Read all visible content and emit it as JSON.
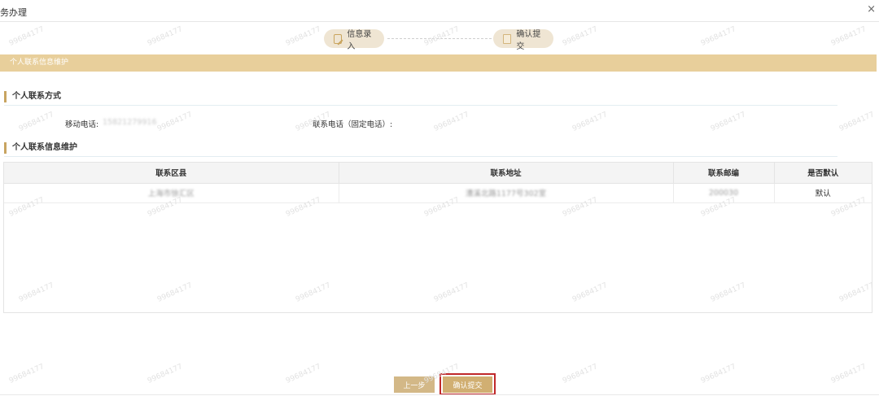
{
  "window": {
    "title": "务办理",
    "close_glyph": "×"
  },
  "stepper": {
    "steps": [
      {
        "label": "信息录入",
        "icon": "edit-icon",
        "state": "current"
      },
      {
        "label": "确认提交",
        "icon": "folder-icon",
        "state": "current"
      }
    ]
  },
  "section": {
    "title": "个人联系信息维护"
  },
  "contact": {
    "heading": "个人联系方式",
    "mobile_label": "移动电话:",
    "mobile_value": "15821279916",
    "phone_label": "联系电话（固定电话）:"
  },
  "maintenance": {
    "heading": "个人联系信息维护",
    "table": {
      "columns": [
        "联系区县",
        "联系地址",
        "联系邮编",
        "是否默认"
      ],
      "rows": [
        {
          "district": "上海市徐汇区",
          "address": "漕溪北路1177号302室",
          "postcode": "200030",
          "default": "默认"
        }
      ]
    }
  },
  "footer": {
    "prev_label": "上一步",
    "submit_label": "确认提交"
  },
  "watermark": {
    "text": "99684177"
  },
  "colors": {
    "accent_gold": "#e8cf9b",
    "step_bg": "#efe5d3",
    "highlight_red": "#c0282a"
  }
}
